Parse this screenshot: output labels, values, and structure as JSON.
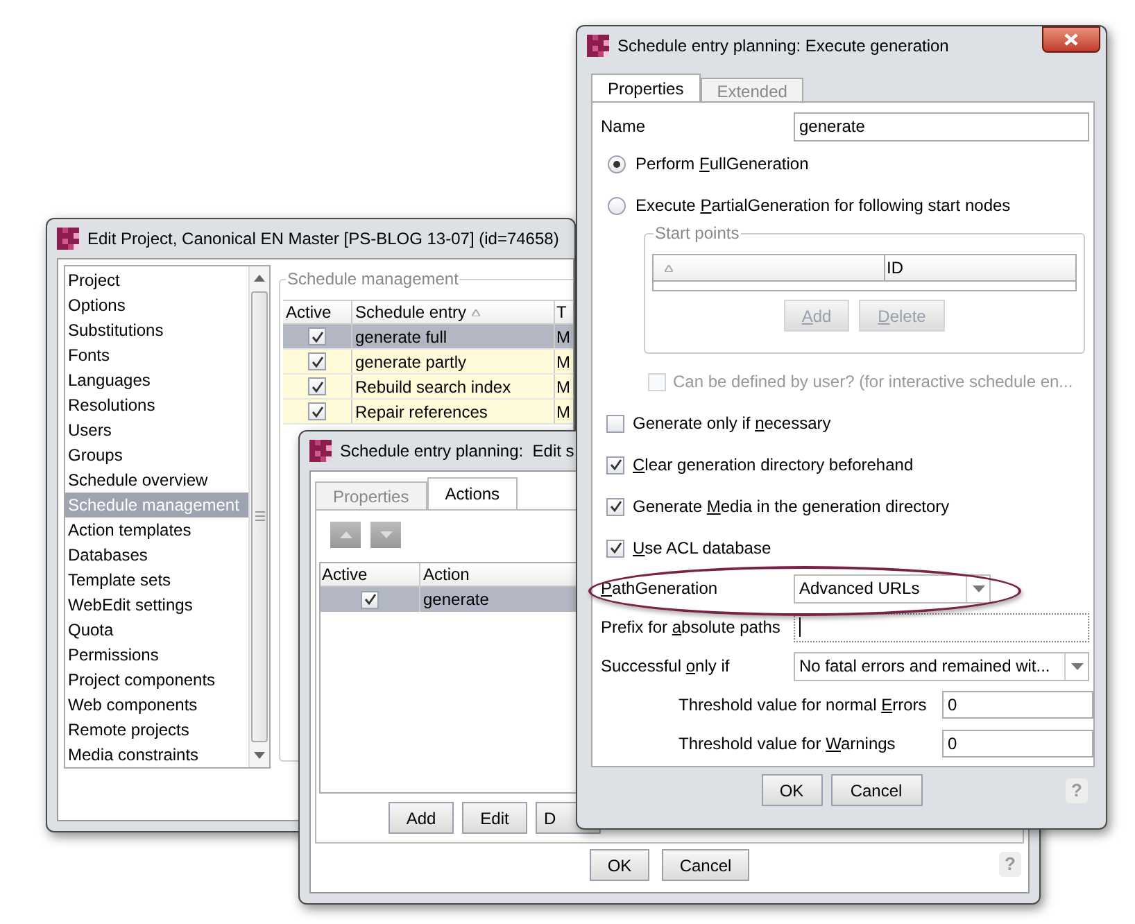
{
  "project_window": {
    "title": "Edit Project, Canonical EN Master [PS-BLOG 13-07] (id=74658)",
    "sidebar": {
      "items": [
        {
          "label": "Project",
          "selected": false
        },
        {
          "label": "Options",
          "selected": false
        },
        {
          "label": "Substitutions",
          "selected": false
        },
        {
          "label": "Fonts",
          "selected": false
        },
        {
          "label": "Languages",
          "selected": false
        },
        {
          "label": "Resolutions",
          "selected": false
        },
        {
          "label": "Users",
          "selected": false
        },
        {
          "label": "Groups",
          "selected": false
        },
        {
          "label": "Schedule overview",
          "selected": false
        },
        {
          "label": "Schedule management",
          "selected": true
        },
        {
          "label": "Action templates",
          "selected": false
        },
        {
          "label": "Databases",
          "selected": false
        },
        {
          "label": "Template sets",
          "selected": false
        },
        {
          "label": "WebEdit settings",
          "selected": false
        },
        {
          "label": "Quota",
          "selected": false
        },
        {
          "label": "Permissions",
          "selected": false
        },
        {
          "label": "Project components",
          "selected": false
        },
        {
          "label": "Web components",
          "selected": false
        },
        {
          "label": "Remote projects",
          "selected": false
        },
        {
          "label": "Media constraints",
          "selected": false
        }
      ]
    },
    "schedule_panel": {
      "legend": "Schedule management",
      "columns": [
        "Active",
        "Schedule entry",
        "T"
      ],
      "rows": [
        {
          "active": true,
          "entry": "generate full",
          "column_3": "M",
          "selected": true
        },
        {
          "active": true,
          "entry": "generate partly",
          "column_3": "M",
          "selected": false
        },
        {
          "active": true,
          "entry": "Rebuild search index",
          "column_3": "M",
          "selected": false
        },
        {
          "active": true,
          "entry": "Repair references",
          "column_3": "M",
          "selected": false
        }
      ]
    }
  },
  "actions_window": {
    "title": "Schedule entry planning:  Edit s",
    "tabs": [
      {
        "label": "Properties",
        "selected": false
      },
      {
        "label": "Actions",
        "selected": true
      }
    ],
    "columns": [
      "Active",
      "Action"
    ],
    "rows": [
      {
        "active": true,
        "action": "generate",
        "selected": true
      }
    ],
    "buttons": [
      "Add",
      "Edit",
      "D"
    ],
    "footer_buttons": [
      "OK",
      "Cancel"
    ],
    "help_button": "?"
  },
  "generation_window": {
    "title": "Schedule entry planning: Execute generation",
    "tabs": [
      {
        "label": "Properties",
        "selected": true
      },
      {
        "label": "Extended",
        "selected": false
      }
    ],
    "name": {
      "label": "Name",
      "value": "generate"
    },
    "generation_mode": [
      {
        "label": {
          "before": "Perform ",
          "key": "F",
          "after": "ullGeneration"
        },
        "selected": true
      },
      {
        "label": {
          "before": "Execute ",
          "key": "P",
          "after": "artialGeneration for following start nodes"
        },
        "selected": false
      }
    ],
    "start_points": {
      "legend": "Start points",
      "column_2": "ID",
      "buttons": [
        {
          "label": {
            "key": "A",
            "after": "dd"
          },
          "disabled": true
        },
        {
          "label": {
            "key": "D",
            "after": "elete"
          },
          "disabled": true
        }
      ]
    },
    "user_definable": {
      "label": "Can be defined by user? (for interactive schedule en...",
      "checked": false,
      "disabled": true
    },
    "options": [
      {
        "label": {
          "before": "Generate only if ",
          "key": "n",
          "after": "ecessary"
        },
        "checked": false
      },
      {
        "label": {
          "key": "C",
          "after": "lear generation directory beforehand"
        },
        "checked": true
      },
      {
        "label": {
          "before": "Generate ",
          "key": "M",
          "after": "edia in the generation directory"
        },
        "checked": true
      },
      {
        "label": {
          "key": "U",
          "after": "se ACL database"
        },
        "checked": true
      }
    ],
    "path_generation": {
      "label": {
        "key": "P",
        "after": "athGeneration"
      },
      "value": "Advanced URLs",
      "highlighted": true
    },
    "prefix": {
      "label": {
        "before": "Prefix for ",
        "key": "a",
        "after": "bsolute paths"
      }
    },
    "successful_only_if": {
      "label": {
        "before": "Successful ",
        "key": "o",
        "after": "nly if"
      },
      "value": "No fatal errors and remained wit..."
    },
    "thresholds": [
      {
        "label": {
          "before": "Threshold value for normal ",
          "key": "E",
          "after": "rrors"
        },
        "value": "0"
      },
      {
        "label": {
          "before": "Threshold value for ",
          "key": "W",
          "after": "arnings"
        },
        "value": "0"
      }
    ],
    "buttons": [
      "OK",
      "Cancel"
    ],
    "help_button": "?"
  }
}
